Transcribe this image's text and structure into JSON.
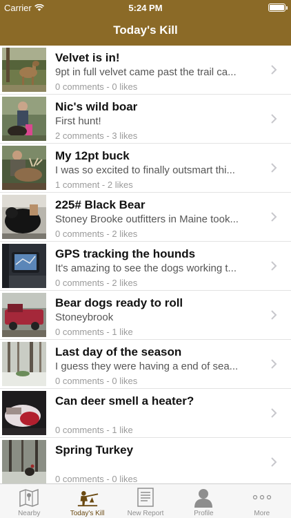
{
  "status": {
    "carrier": "Carrier",
    "time": "5:24 PM"
  },
  "nav": {
    "title": "Today's Kill"
  },
  "colors": {
    "brand": "#8b6a27",
    "tab_active": "#6b4a12",
    "meta": "#9a9a9a"
  },
  "posts": [
    {
      "title": "Velvet is in!",
      "desc": "9pt in full velvet came past the trail ca...",
      "meta": "0 comments - 0 likes",
      "thumb": "deer-field"
    },
    {
      "title": "Nic's wild boar",
      "desc": "First hunt!",
      "meta": "2 comments - 3 likes",
      "thumb": "hunter-boar"
    },
    {
      "title": "My 12pt buck",
      "desc": "I was so excited to finally outsmart thi...",
      "meta": "1 comment - 2 likes",
      "thumb": "hunter-buck"
    },
    {
      "title": "225# Black Bear",
      "desc": "Stoney Brooke outfitters in Maine took...",
      "meta": "0 comments - 2 likes",
      "thumb": "black-bear"
    },
    {
      "title": "GPS tracking the hounds",
      "desc": "It's amazing to see the dogs working t...",
      "meta": "0 comments - 2 likes",
      "thumb": "gps-device"
    },
    {
      "title": "Bear dogs ready to roll",
      "desc": "Stoneybrook",
      "meta": "0 comments - 1 like",
      "thumb": "red-truck"
    },
    {
      "title": "Last day of the season",
      "desc": "I guess they were having a end of sea...",
      "meta": "0 comments - 0 likes",
      "thumb": "snowy-woods"
    },
    {
      "title": "Can deer smell a heater?",
      "desc": "",
      "meta": "0 comments - 1 like",
      "thumb": "heater"
    },
    {
      "title": "Spring Turkey",
      "desc": "",
      "meta": "0 comments - 0 likes",
      "thumb": "turkey-woods"
    }
  ],
  "tabs": [
    {
      "label": "Nearby",
      "icon": "map-icon",
      "active": false
    },
    {
      "label": "Today's Kill",
      "icon": "hunter-icon",
      "active": true
    },
    {
      "label": "New Report",
      "icon": "document-icon",
      "active": false
    },
    {
      "label": "Profile",
      "icon": "person-icon",
      "active": false
    },
    {
      "label": "More",
      "icon": "more-icon",
      "active": false
    }
  ]
}
